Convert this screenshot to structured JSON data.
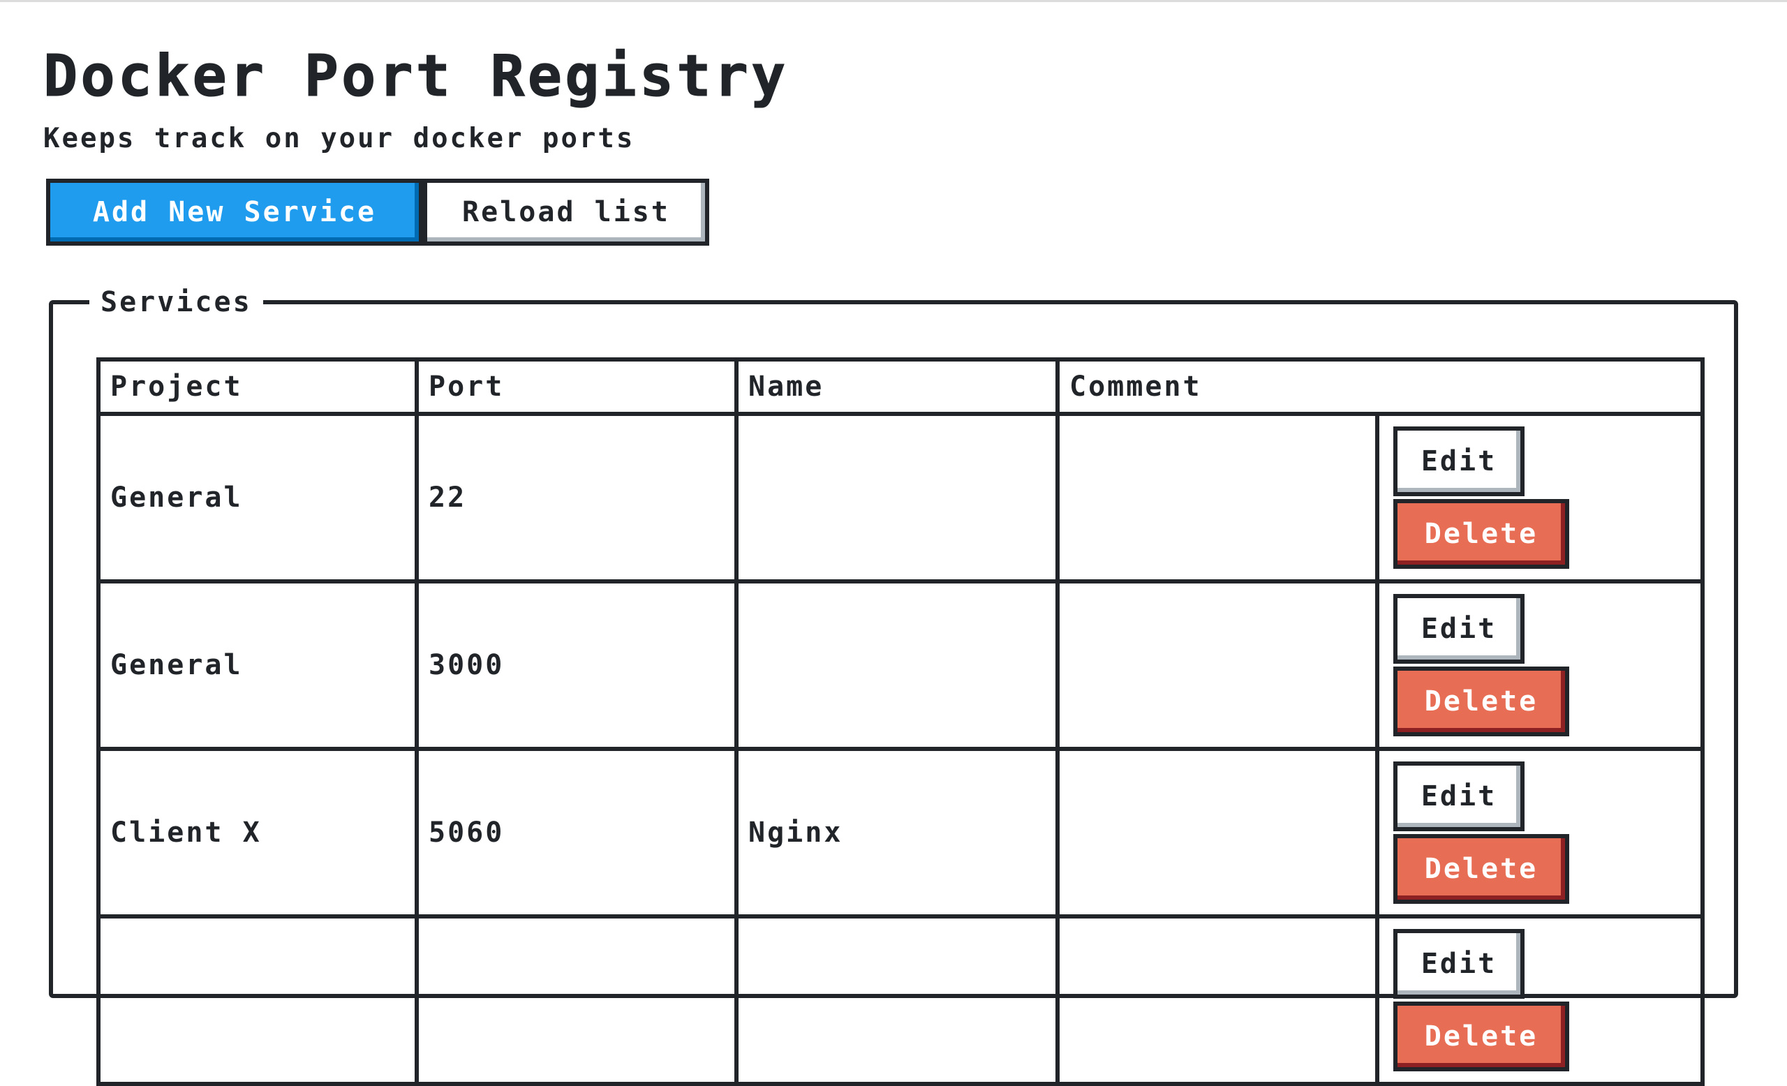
{
  "header": {
    "title": "Docker Port Registry",
    "subtitle": "Keeps track on your docker ports"
  },
  "actions": {
    "add_label": "Add New Service",
    "reload_label": "Reload list"
  },
  "services": {
    "legend": "Services",
    "columns": [
      "Project",
      "Port",
      "Name",
      "Comment"
    ],
    "edit_label": "Edit",
    "delete_label": "Delete",
    "rows": [
      {
        "project": "General",
        "port": "22",
        "name": "",
        "comment": ""
      },
      {
        "project": "General",
        "port": "3000",
        "name": "",
        "comment": ""
      },
      {
        "project": "Client X",
        "port": "5060",
        "name": "Nginx",
        "comment": ""
      },
      {
        "project": "",
        "port": "",
        "name": "",
        "comment": ""
      }
    ]
  },
  "colors": {
    "primary": "#209cee",
    "danger": "#e76e55",
    "text": "#212529"
  }
}
